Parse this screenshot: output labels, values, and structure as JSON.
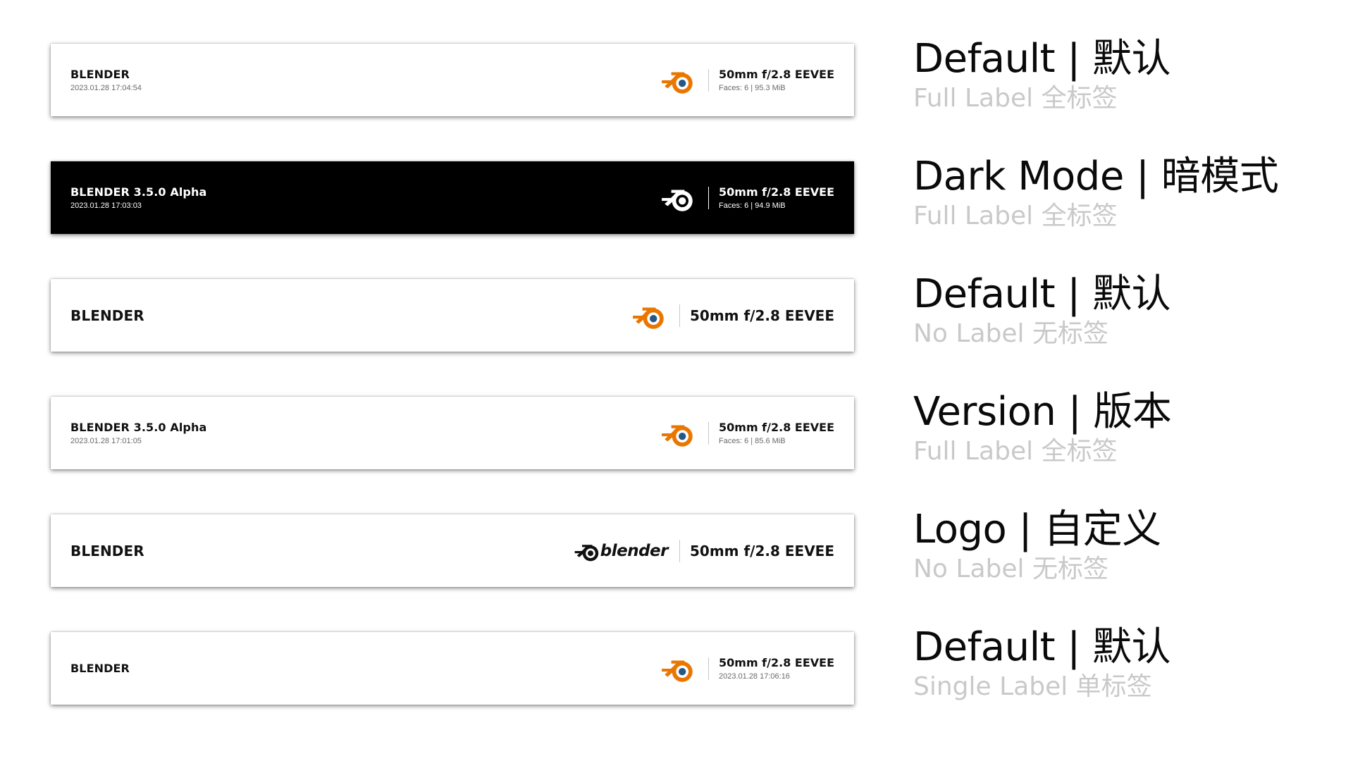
{
  "colors": {
    "accent_orange": "#ea7600",
    "eye_blue": "#265787",
    "caption_gray": "#c9c9c9",
    "dark_background": "#000000"
  },
  "icons": {
    "blender_logo": "blender-logo-icon",
    "blender_wordmark": "blender-wordmark-logo"
  },
  "rows": [
    {
      "brand": "BLENDER",
      "timestamp": "2023.01.28 17:04:54",
      "lens": "50mm f/2.8 EEVEE",
      "meta": "Faces: 6 | 95.3 MiB",
      "caption_title": "Default | 默认",
      "caption_sub": "Full Label 全标签"
    },
    {
      "brand": "BLENDER 3.5.0 Alpha",
      "timestamp": "2023.01.28 17:03:03",
      "lens": "50mm f/2.8 EEVEE",
      "meta": "Faces: 6 | 94.9 MiB",
      "caption_title": "Dark Mode | 暗模式",
      "caption_sub": "Full Label 全标签"
    },
    {
      "brand": "BLENDER",
      "lens": "50mm f/2.8 EEVEE",
      "caption_title": "Default | 默认",
      "caption_sub": "No Label 无标签"
    },
    {
      "brand": "BLENDER 3.5.0 Alpha",
      "timestamp": "2023.01.28 17:01:05",
      "lens": "50mm f/2.8 EEVEE",
      "meta": "Faces: 6 | 85.6 MiB",
      "caption_title": "Version | 版本",
      "caption_sub": "Full Label 全标签"
    },
    {
      "brand": "BLENDER",
      "logo_text": "blender",
      "lens": "50mm f/2.8 EEVEE",
      "caption_title": "Logo | 自定义",
      "caption_sub": "No Label 无标签"
    },
    {
      "brand": "BLENDER",
      "lens": "50mm f/2.8 EEVEE",
      "meta": "2023.01.28 17:06:16",
      "caption_title": "Default | 默认",
      "caption_sub": "Single Label 单标签"
    }
  ]
}
